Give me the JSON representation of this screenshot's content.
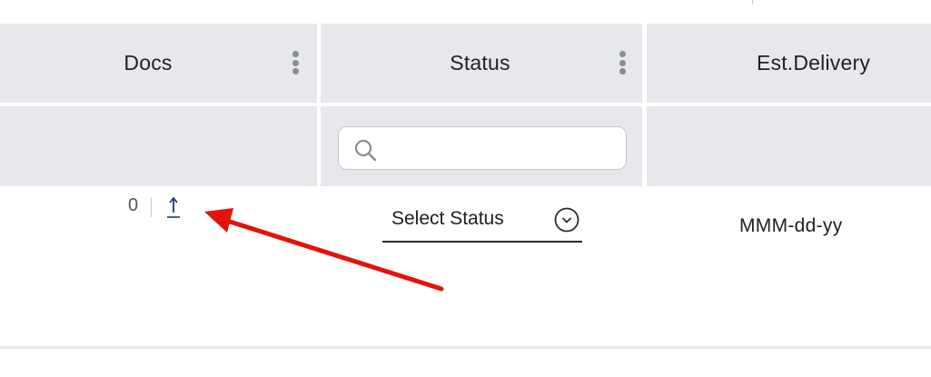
{
  "columns": [
    {
      "label": "Docs"
    },
    {
      "label": "Status"
    },
    {
      "label": "Est.Delivery"
    }
  ],
  "filter": {
    "status_search_value": "",
    "status_search_placeholder": ""
  },
  "row": {
    "docs_count": "0",
    "status_select_label": "Select Status",
    "est_delivery": "MMM-dd-yy"
  },
  "icons": {
    "kebab": "vertical-dots-icon",
    "search": "search-icon",
    "upload": "upload-arrow-icon",
    "dropdown": "chevron-down-circle-icon"
  },
  "colors": {
    "header_bg": "#e7e8eb",
    "annotation_arrow": "#e3120b",
    "upload_link": "#1f3a6b"
  }
}
